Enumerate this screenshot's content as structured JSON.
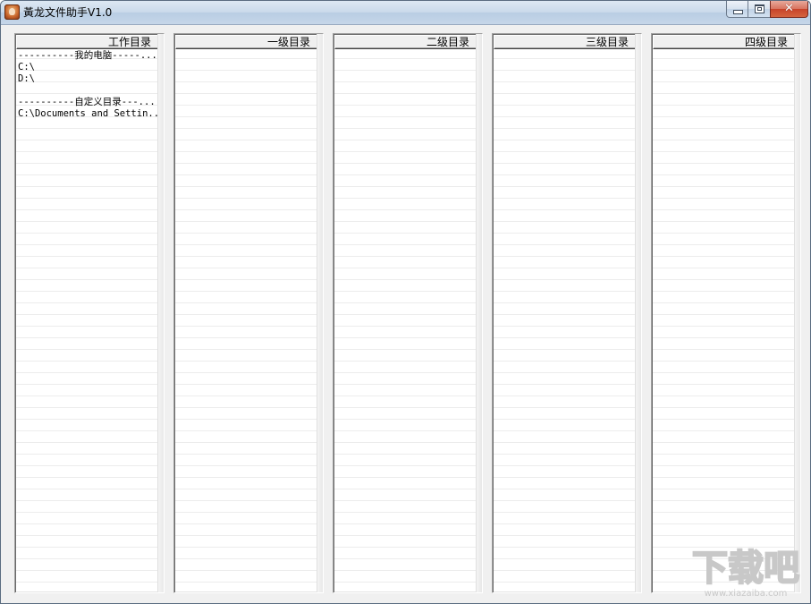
{
  "window": {
    "title": "黃龙文件助手V1.0"
  },
  "panels": [
    {
      "header": "工作目录",
      "items": [
        "----------我的电脑-----...",
        "C:\\",
        "D:\\",
        "",
        "----------自定义目录---...",
        "C:\\Documents and Settin..."
      ]
    },
    {
      "header": "一级目录",
      "items": []
    },
    {
      "header": "二级目录",
      "items": []
    },
    {
      "header": "三级目录",
      "items": []
    },
    {
      "header": "四级目录",
      "items": []
    }
  ],
  "watermark": {
    "main_text": "下载吧",
    "sub_text": "www.xiazaiba.com"
  },
  "colors": {
    "titlebar_top": "#dde8f3",
    "close_button": "#c7432a",
    "list_background": "#ffffff",
    "row_line": "#ececec",
    "watermark": "#c8c8c8"
  },
  "icons": {
    "app": "app-logo-icon",
    "minimize": "minimize-icon",
    "maximize": "maximize-icon",
    "close": "close-icon"
  }
}
